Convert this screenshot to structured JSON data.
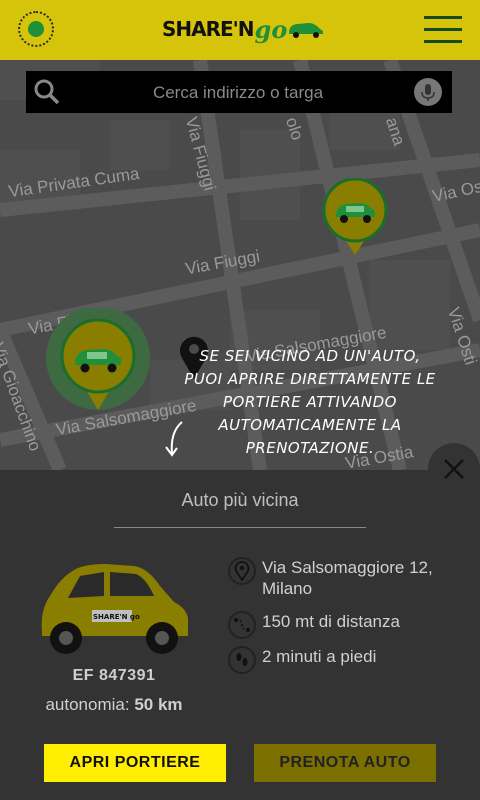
{
  "header": {
    "logo_share": "SHARE'N",
    "logo_go": "go"
  },
  "search": {
    "placeholder": "Cerca indirizzo o targa"
  },
  "map": {
    "streets": [
      "Via Privata Cuma",
      "Via Fiuggi",
      "Via Fiuggi",
      "Via Fiuggi",
      "Via Salsomaggiore",
      "Via Gioacchino",
      "Via Salsomaggiore",
      "Via Ostia",
      "Via Ostia",
      "olo",
      "ana",
      "Via Osti"
    ]
  },
  "tutorial": {
    "message": "Se sei vicino ad un'auto, puoi aprire direttamente le portiere attivando automaticamente la prenotazione."
  },
  "panel": {
    "title": "Auto più vicina",
    "plate": "EF 847391",
    "autonomy_label": "autonomia:",
    "autonomy_value": "50 km",
    "address": "Via Salsomaggiore 12, Milano",
    "distance": "150 mt di distanza",
    "walk_time": "2 minuti a piedi"
  },
  "actions": {
    "open_doors": "APRI PORTIERE",
    "book_car": "PRENOTA AUTO"
  },
  "colors": {
    "brand_yellow": "#ffee00",
    "brand_green": "#1f8f3a"
  }
}
